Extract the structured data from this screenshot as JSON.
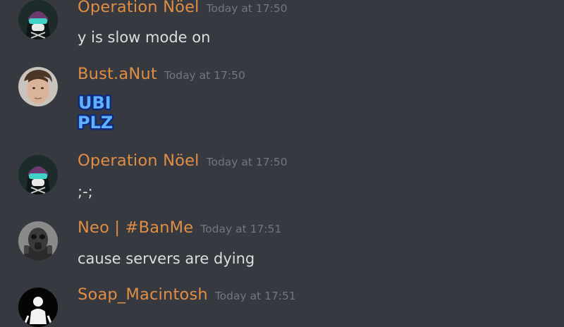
{
  "messages": [
    {
      "username": "Operation Nöel",
      "timestamp": "Today at 17:50",
      "content": "y is slow mode on",
      "avatar_icon": "masked-operator-avatar",
      "name_color": "#e08e45"
    },
    {
      "username": "Bust.aNut",
      "timestamp": "Today at 17:50",
      "emote": {
        "line1": "UBI",
        "line2": "PLZ",
        "icon": "ubi-plz-emote"
      },
      "avatar_icon": "face-photo-avatar",
      "name_color": "#e08e45"
    },
    {
      "username": "Operation Nöel",
      "timestamp": "Today at 17:50",
      "content": ";-;",
      "avatar_icon": "masked-operator-avatar",
      "name_color": "#e08e45"
    },
    {
      "username": "Neo | #BanMe",
      "timestamp": "Today at 17:51",
      "content": "cause servers are dying",
      "avatar_icon": "gas-mask-avatar",
      "name_color": "#e08e45"
    },
    {
      "username": "Soap_Macintosh",
      "timestamp": "Today at 17:51",
      "avatar_icon": "soldier-silhouette-avatar",
      "name_color": "#e08e45"
    }
  ],
  "colors": {
    "background": "#36393f",
    "username": "#e08e45",
    "timestamp": "#72767d",
    "text": "#dcddde"
  }
}
